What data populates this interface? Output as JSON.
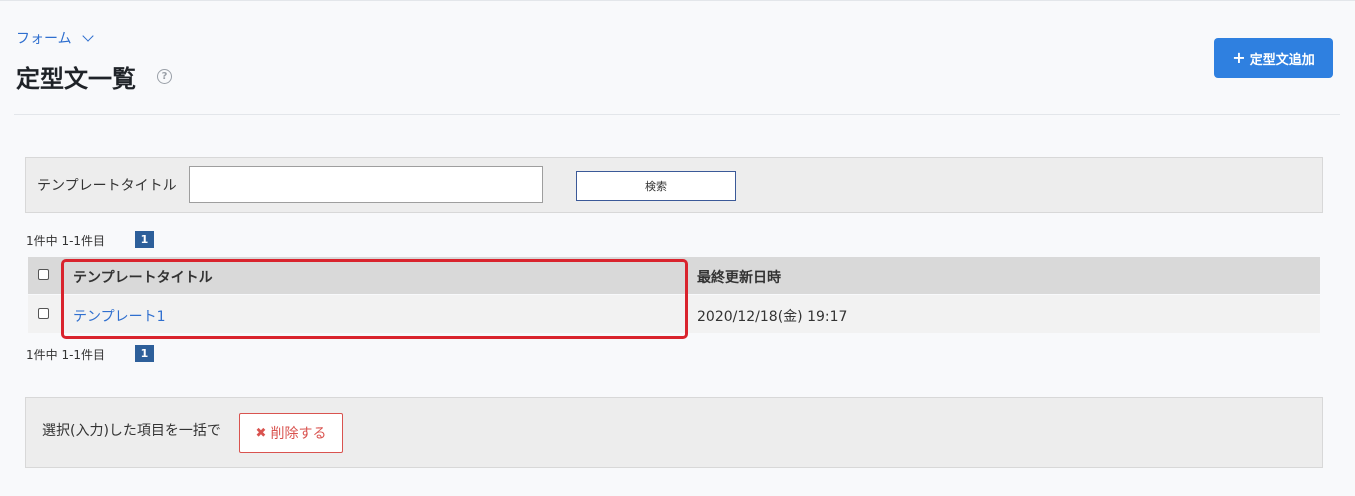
{
  "breadcrumb": {
    "label": "フォーム"
  },
  "page": {
    "title": "定型文一覧",
    "help_icon": "?"
  },
  "header": {
    "add_button_label": "定型文追加",
    "add_icon": "+"
  },
  "search": {
    "label": "テンプレートタイトル",
    "value": "",
    "placeholder": "",
    "button_label": "検索"
  },
  "pagination": {
    "summary": "1件中 1-1件目",
    "current_page": "1"
  },
  "table": {
    "columns": [
      "テンプレートタイトル",
      "最終更新日時"
    ],
    "rows": [
      {
        "title": "テンプレート1",
        "updated_at": "2020/12/18(金) 19:17"
      }
    ]
  },
  "bulk": {
    "label": "選択(入力)した項目を一括で",
    "delete_label": "削除する",
    "delete_icon": "✖"
  },
  "colors": {
    "accent": "#2f80e0",
    "link": "#2f6fcf",
    "danger": "#d9534f",
    "highlight": "#d9232d",
    "page_badge": "#2d5f9a"
  }
}
